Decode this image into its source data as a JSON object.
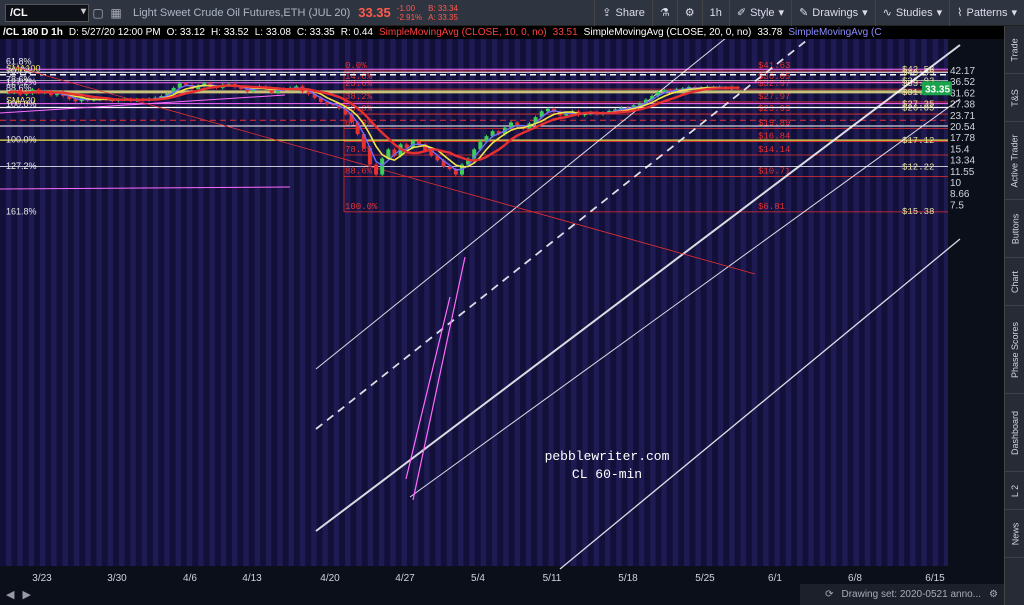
{
  "toolbar": {
    "symbol": "/CL",
    "description": "Light Sweet Crude Oil Futures,ETH (JUL 20)",
    "last": "33.35",
    "change": "-1.00",
    "change_pct": "-2.91%",
    "bid": "B: 33.34",
    "ask": "A: 33.35",
    "share": "Share",
    "interval": "1h",
    "style": "Style",
    "drawings": "Drawings",
    "studies": "Studies",
    "patterns": "Patterns",
    "icons": [
      "chevron-down-icon",
      "square-icon",
      "grid-icon",
      "share-icon",
      "flask-icon",
      "gear-icon",
      "chevron-down-icon",
      "drawings-icon",
      "studies-icon",
      "patterns-icon"
    ]
  },
  "info": {
    "header": "/CL 180 D 1h",
    "date": "D: 5/27/20 12:00 PM",
    "open": "O: 33.12",
    "high": "H: 33.52",
    "low": "L: 33.08",
    "close": "C: 33.35",
    "range": "R: 0.44",
    "sma10_label": "SimpleMovingAvg (CLOSE, 10, 0, no)",
    "sma10_val": "33.51",
    "sma20_label": "SimpleMovingAvg (CLOSE, 20, 0, no)",
    "sma20_val": "33.78",
    "sma3_label": "SimpleMovingAvg (C"
  },
  "side_tabs": [
    "Trade",
    "T&S",
    "Active Trader",
    "Buttons",
    "Chart",
    "Phase Scores",
    "Dashboard",
    "L 2",
    "News"
  ],
  "status": {
    "text": "Drawing set: 2020-0521 anno...",
    "icons": [
      "sync-icon",
      "settings-icon"
    ]
  },
  "bottom_left_icons": [
    "scroll-left-icon",
    "scroll-right-icon"
  ],
  "watermark": [
    "pebblewriter.com",
    "CL 60-min"
  ],
  "colors": {
    "bg": "#120f38",
    "stripe": "#1e1a52",
    "red": "#e83030",
    "yellow": "#f1e64a",
    "blue": "#6e6cff",
    "magenta": "#ff6aff",
    "white": "#ffffff"
  },
  "chart_data": {
    "type": "candlestick",
    "title": "Light Sweet Crude Oil Futures,ETH (JUL 20)",
    "interval": "1h",
    "x_ticks": [
      "3/23",
      "3/30",
      "4/6",
      "4/13",
      "4/20",
      "4/27",
      "5/4",
      "5/11",
      "5/18",
      "5/25",
      "6/1",
      "6/8",
      "6/15"
    ],
    "y_ticks": [
      7.5,
      8.66,
      10,
      11.55,
      13.34,
      15.4,
      17.78,
      20.54,
      23.71,
      27.38,
      31.62,
      36.52,
      42.17
    ],
    "ylim": [
      6.6,
      48
    ],
    "log_scale": true,
    "last_price": 33.35,
    "right_labels": [
      {
        "text": "$42.58",
        "value": 42.58
      },
      {
        "text": "$40.95",
        "value": 40.95
      },
      {
        "text": "$36.93",
        "value": 36.93
      },
      {
        "text": "$35.77",
        "value": 35.77
      },
      {
        "text": "$31.81",
        "value": 31.81
      },
      {
        "text": "$27.35",
        "value": 27.35
      },
      {
        "text": "$26.05",
        "value": 26.05
      },
      {
        "text": "$17.12",
        "value": 17.12
      },
      {
        "text": "$12.22",
        "value": 12.22
      },
      {
        "text": "$15.38",
        "value": 6.9
      }
    ],
    "fib_red": [
      {
        "pct": "0.0%",
        "price": "$41.63",
        "value": 41.63
      },
      {
        "pct": "14.6%",
        "price": "$36.05",
        "value": 36.05
      },
      {
        "pct": "23.6%",
        "price": "$32.97",
        "value": 32.97
      },
      {
        "pct": "38.2%",
        "price": "$27.97",
        "value": 27.97
      },
      {
        "pct": "50.0%",
        "price": "$23.93",
        "value": 23.93
      },
      {
        "pct": "61.8%",
        "price": "$19.89",
        "value": 19.89
      },
      {
        "pct": "",
        "price": "$16.84",
        "value": 16.84
      },
      {
        "pct": "78.6%",
        "price": "$14.14",
        "value": 14.14
      },
      {
        "pct": "88.6%",
        "price": "$10.71",
        "value": 10.71
      },
      {
        "pct": "100.0%",
        "price": "$6.81",
        "value": 6.81
      }
    ],
    "left_labels": [
      {
        "text": "61.8%",
        "value": 47
      },
      {
        "text": "SMA100",
        "value": 43
      },
      {
        "text": "70.7%",
        "value": 41.5
      },
      {
        "text": "78.6%",
        "value": 37.3
      },
      {
        "text": "127.2%",
        "value": 36.2
      },
      {
        "text": "88.6%",
        "value": 33.5
      },
      {
        "text": "SMA20",
        "value": 28.5
      },
      {
        "text": "100.0%",
        "value": 27.2
      },
      {
        "text": "100.0%",
        "value": 17.3
      },
      {
        "text": "127.2%",
        "value": 12.3
      },
      {
        "text": "161.8%",
        "value": 6.85
      }
    ],
    "series": [
      {
        "name": "SMA 10",
        "value": 33.51
      },
      {
        "name": "SMA 20",
        "value": 33.78
      }
    ],
    "close": [
      31.5,
      32.5,
      30.8,
      31.2,
      32.8,
      31.5,
      32.1,
      30.5,
      31.8,
      30.2,
      29.0,
      28.2,
      29.5,
      28.5,
      28.9,
      29.2,
      28.7,
      28.4,
      28.8,
      29.0,
      28.5,
      28.9,
      28.6,
      29.1,
      29.5,
      30.2,
      31.2,
      33.5,
      35.5,
      34.8,
      33.0,
      34.5,
      35.5,
      34.2,
      33.5,
      34.8,
      35.2,
      33.9,
      33.0,
      32.0,
      33.5,
      34.2,
      33.0,
      31.5,
      33.2,
      32.7,
      33.5,
      34.2,
      32.0,
      31.0,
      29.5,
      28.0,
      27.2,
      26.8,
      25.8,
      24.0,
      21.5,
      18.5,
      15.5,
      12.5,
      11.0,
      13.5,
      15.2,
      14.0,
      16.2,
      15.5,
      17.0,
      16.2,
      15.0,
      14.0,
      13.2,
      12.2,
      11.8,
      11.0,
      12.5,
      13.5,
      15.2,
      16.8,
      18.0,
      19.2,
      18.5,
      20.1,
      21.5,
      20.5,
      19.8,
      21.2,
      23.0,
      24.8,
      25.6,
      24.6,
      23.5,
      24.2,
      24.8,
      23.6,
      24.0,
      24.5,
      23.9,
      24.3,
      24.9,
      25.4,
      26.0,
      25.5,
      26.8,
      27.5,
      28.8,
      30.2,
      31.8,
      32.5,
      32.0,
      32.9,
      33.3,
      33.9,
      33.1,
      33.6,
      34.0,
      33.5,
      33.8,
      33.2,
      33.9,
      33.35
    ]
  }
}
